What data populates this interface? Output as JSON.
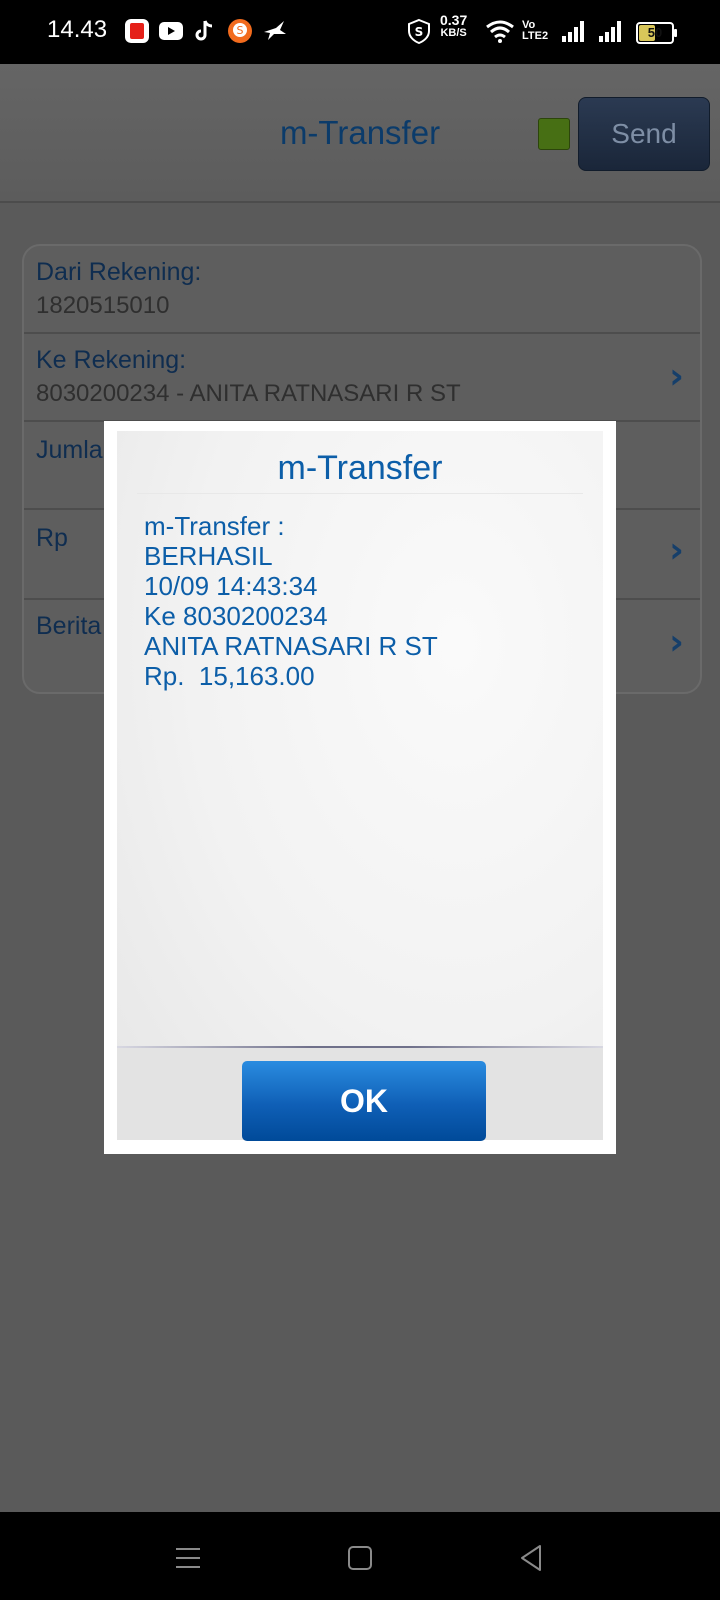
{
  "status_bar": {
    "time": "14.43",
    "net_speed_value": "0.37",
    "net_speed_unit": "KB/S",
    "volte_top": "Vo",
    "volte_bottom": "LTE2",
    "battery": "50"
  },
  "header": {
    "title": "m-Transfer",
    "send_label": "Send"
  },
  "form": {
    "rows": [
      {
        "label": "Dari Rekening:",
        "value": "1820515010"
      },
      {
        "label": "Ke Rekening:",
        "value": "8030200234 - ANITA RATNASARI R ST"
      },
      {
        "label": "Jumlah",
        "value": ""
      },
      {
        "label": "Rp",
        "value": ""
      },
      {
        "label": "Berita",
        "value": ""
      }
    ]
  },
  "dialog": {
    "title": "m-Transfer",
    "lines": [
      "m-Transfer :",
      "BERHASIL",
      "10/09 14:43:34",
      "Ke 8030200234",
      "ANITA RATNASARI R ST",
      "Rp.  15,163.00"
    ],
    "ok_label": "OK"
  },
  "colors": {
    "accent": "#0c5ea8",
    "status_square": "#476f14",
    "ok_button": "#0f5fb6"
  }
}
